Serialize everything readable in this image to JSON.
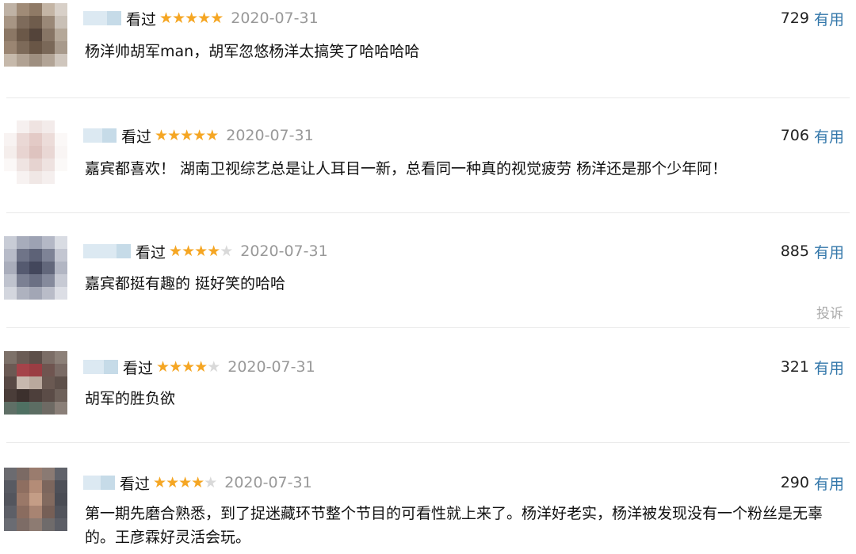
{
  "reviews": [
    {
      "status": "看过",
      "rating": 5,
      "date": "2020-07-31",
      "votes": "729",
      "useful_label": "有用",
      "comment": "杨洋帅胡军man，胡军忽悠杨洋太搞笑了哈哈哈哈",
      "avatar_colors": [
        "#bfb2a5",
        "#a08b77",
        "#8f7a66",
        "#c4b5a5",
        "#d8d0c8",
        "#a79584",
        "#7e6b5b",
        "#6f5c4c",
        "#9a8877",
        "#c9c0b6",
        "#8b7765",
        "#6b5848",
        "#54443a",
        "#877565",
        "#b5a899",
        "#9a8572",
        "#7d6a59",
        "#695646",
        "#7a6858",
        "#a89a8c",
        "#c6b9ab",
        "#b1a293",
        "#9e8f80",
        "#b2a496",
        "#cfc6bd"
      ]
    },
    {
      "status": "看过",
      "rating": 5,
      "date": "2020-07-31",
      "votes": "706",
      "useful_label": "有用",
      "comment": "嘉宾都喜欢！ 湖南卫视综艺总是让人耳目一新，总看同一种真的视觉疲劳 杨洋还是那个少年阿！",
      "avatar_colors": [
        "#ffffff",
        "#f6f0ef",
        "#efe3e1",
        "#f3ebea",
        "#ffffff",
        "#f8f3f2",
        "#ead8d5",
        "#e3cac6",
        "#ecdcd9",
        "#fbf8f7",
        "#f5eeec",
        "#e8d4d1",
        "#dec3bf",
        "#e9d7d4",
        "#f9f5f4",
        "#fbf8f7",
        "#efe4e2",
        "#e6d3d0",
        "#eee2e0",
        "#fbf9f8",
        "#ffffff",
        "#f7f2f1",
        "#f0e7e5",
        "#f5efee",
        "#ffffff"
      ]
    },
    {
      "status": "看过",
      "rating": 4,
      "date": "2020-07-31",
      "votes": "885",
      "useful_label": "有用",
      "comment": "嘉宾都挺有趣的 挺好笑的哈哈",
      "report_label": "投诉",
      "avatar_colors": [
        "#c8ccd6",
        "#a7acbb",
        "#9da2b3",
        "#b4b8c6",
        "#d9dce3",
        "#b7bbc8",
        "#6f7488",
        "#5d6277",
        "#7e8396",
        "#c3c6d1",
        "#a9adbb",
        "#555a70",
        "#43475c",
        "#62677b",
        "#b2b6c3",
        "#bfc3ce",
        "#7b8093",
        "#6b7084",
        "#858a9c",
        "#c7cad4",
        "#d3d6de",
        "#aeb2bf",
        "#a2a6b5",
        "#b9bcc8",
        "#dcdee5"
      ]
    },
    {
      "status": "看过",
      "rating": 4,
      "date": "2020-07-31",
      "votes": "321",
      "useful_label": "有用",
      "comment": "胡军的胜负欲",
      "avatar_colors": [
        "#7d7169",
        "#6a5c55",
        "#5d4f49",
        "#7b6d66",
        "#8c8078",
        "#6b5a54",
        "#a5434a",
        "#9a3d43",
        "#6f5550",
        "#7a6b65",
        "#584945",
        "#c7b8ae",
        "#b9a89d",
        "#6a5952",
        "#5e504a",
        "#4a3d39",
        "#3c302d",
        "#4d3f3b",
        "#5b4c47",
        "#6e615a",
        "#5f6f66",
        "#4f7062",
        "#5c6d63",
        "#6e6a64",
        "#8a7f78"
      ]
    },
    {
      "status": "看过",
      "rating": 4,
      "date": "2020-07-31",
      "votes": "290",
      "useful_label": "有用",
      "comment": "第一期先磨合熟悉，到了捉迷藏环节整个节目的可看性就上来了。杨洋好老实，杨洋被发现没有一个粉丝是无辜的。王彦霖好灵活会玩。",
      "avatar_colors": [
        "#6b6b70",
        "#7b6a64",
        "#9a7c6e",
        "#8a7a73",
        "#60626a",
        "#585a62",
        "#8e6e60",
        "#b48c77",
        "#7c665d",
        "#4e5058",
        "#53555d",
        "#9a7868",
        "#c49d86",
        "#826a5f",
        "#4a4c54",
        "#5d5f67",
        "#8a6c5f",
        "#a88472",
        "#765f56",
        "#52545c",
        "#6a6c73",
        "#7d6c66",
        "#8d7b72",
        "#6f6b6b",
        "#5c5e66"
      ]
    }
  ]
}
